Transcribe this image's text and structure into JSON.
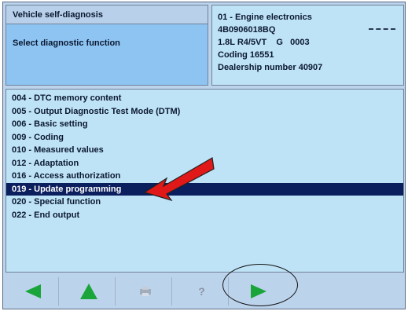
{
  "header": {
    "title": "Vehicle self-diagnosis",
    "subtitle": "Select diagnostic function"
  },
  "vehicle_info": {
    "line1": "01 - Engine electronics",
    "line2": "4B0906018BQ",
    "line3": "1.8L R4/5VT    G   0003",
    "line4": "Coding 16551",
    "line5": "Dealership number 40907"
  },
  "functions": [
    {
      "label": "004 - DTC memory content"
    },
    {
      "label": "005 - Output Diagnostic Test Mode (DTM)"
    },
    {
      "label": "006 - Basic setting"
    },
    {
      "label": "009 - Coding"
    },
    {
      "label": "010 - Measured values"
    },
    {
      "label": "012 - Adaptation"
    },
    {
      "label": "016 - Access authorization"
    },
    {
      "label": "019 - Update programming",
      "selected": true
    },
    {
      "label": "020 - Special function"
    },
    {
      "label": "022 - End output"
    }
  ],
  "toolbar": {
    "back_icon": "left-arrow-icon",
    "up_icon": "up-arrow-icon",
    "print_icon": "print-icon",
    "help_label": "?",
    "next_icon": "right-arrow-icon",
    "active_color": "#1aa53a",
    "disabled_color": "#8a96a6"
  },
  "selection_color": "#0b1e5e",
  "annotation_arrow_color": "#e01818"
}
